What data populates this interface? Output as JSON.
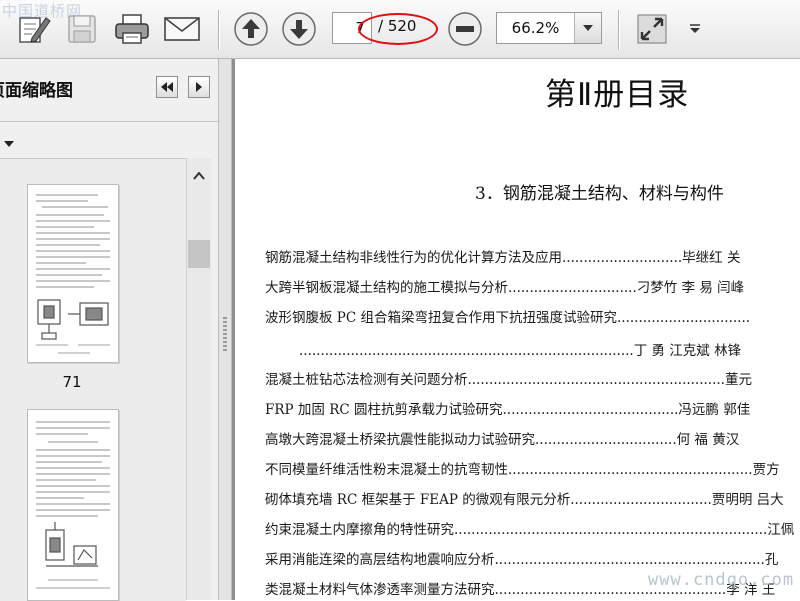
{
  "watermarks": {
    "top": "中国道桥网",
    "bottom": "www.cndqo.com"
  },
  "toolbar": {
    "page": {
      "current": "7",
      "total": "/ 520"
    },
    "zoom": {
      "value": "66.2%"
    },
    "icons": [
      "edit-icon",
      "save-icon",
      "print-icon",
      "email-icon",
      "previous-page-icon",
      "next-page-icon",
      "zoom-out-icon",
      "zoom-dropdown-icon",
      "fullscreen-icon",
      "toolbar-menu-icon"
    ],
    "highlight_color": "#e01010"
  },
  "sidebar": {
    "title": "页面缩略图",
    "thumbnail_label": "71"
  },
  "document": {
    "title": "第Ⅱ册目录",
    "section": "3．钢筋混凝土结构、材料与构件",
    "toc": [
      "钢筋混凝土结构非线性行为的优化计算方法及应用............................毕继红  关",
      "大跨半钢板混凝土结构的施工模拟与分析..............................刁梦竹  李  易  闫峰",
      "波形钢腹板 PC 组合箱梁弯扭复合作用下抗扭强度试验研究...............................",
      "..............................................................................丁  勇  江克斌  林锋",
      "混凝土桩钻芯法检测有关问题分析............................................................董元",
      "FRP 加固 RC 圆柱抗剪承载力试验研究.........................................冯远鹏  郭佳",
      "高墩大跨混凝土桥梁抗震性能拟动力试验研究.................................何  福  黄汉",
      "不同模量纤维活性粉末混凝土的抗弯韧性.........................................................贾方",
      "砌体填充墙 RC 框架基于 FEAP 的微观有限元分析.................................贾明明  吕大",
      "约束混凝土内摩擦角的特性研究.........................................................................江佩",
      "采用消能连梁的高层结构地震响应分析...............................................................孔",
      "类混凝土材料气体渗透率测量方法研究......................................................李  洋  王"
    ]
  }
}
